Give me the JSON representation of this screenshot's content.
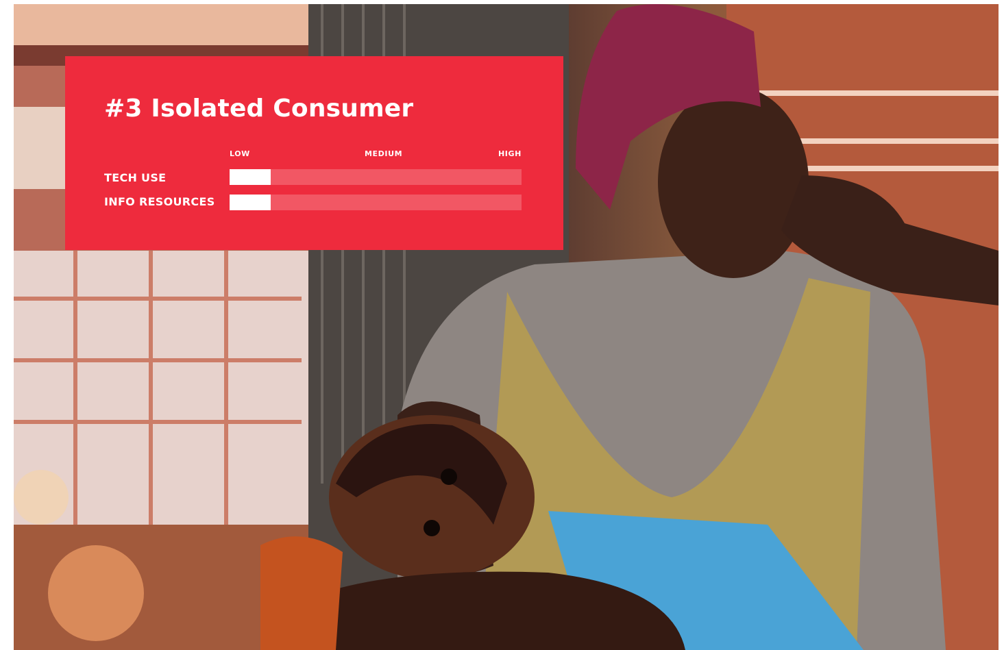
{
  "card": {
    "title": "#3 Isolated Consumer",
    "background_color": "#ee2b3d",
    "scale": {
      "low": "LOW",
      "medium": "MEDIUM",
      "high": "HIGH"
    },
    "rows": [
      {
        "label": "TECH USE",
        "level": 0.14
      },
      {
        "label": "INFO RESOURCES",
        "level": 0.14
      }
    ]
  },
  "photo": {
    "subject": "photo-mother-and-infant"
  }
}
